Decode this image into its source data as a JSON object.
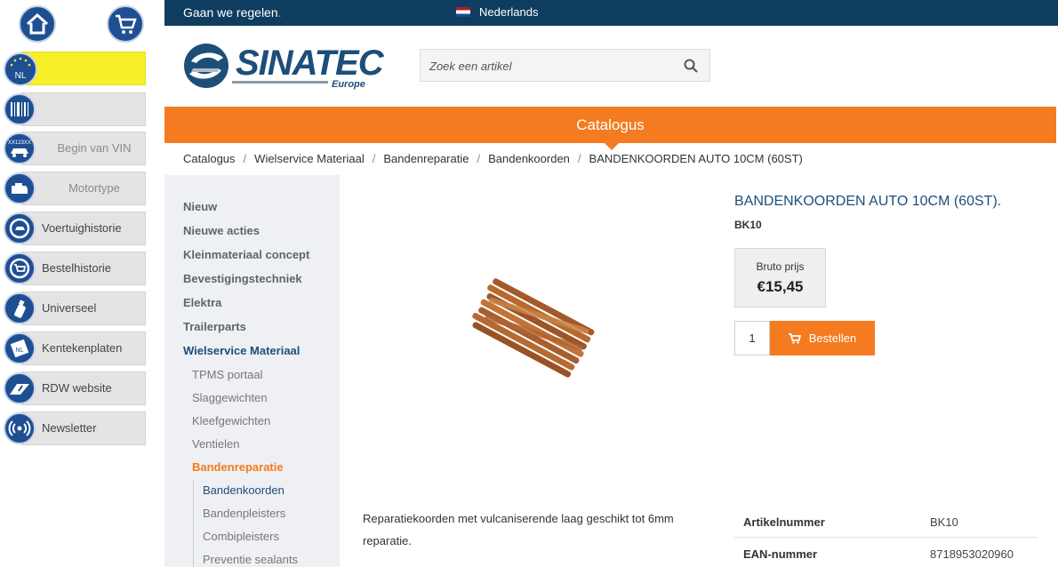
{
  "topbar": {
    "tagline": "Gaan we regelen",
    "tagline_dot": ".",
    "language": "Nederlands"
  },
  "left_sidebar": {
    "country_badge": "NL",
    "items": [
      {
        "label": ""
      },
      {
        "label": "Begin van VIN",
        "icon_text": "XX123XX"
      },
      {
        "label": "Motortype"
      },
      {
        "label": "Voertuighistorie"
      },
      {
        "label": "Bestelhistorie"
      },
      {
        "label": "Universeel"
      },
      {
        "label": "Kentekenplaten",
        "icon_text": "NL"
      },
      {
        "label": "RDW website"
      },
      {
        "label": "Newsletter"
      }
    ]
  },
  "header": {
    "logo_text": "SINATEC",
    "logo_subtext": "Europe",
    "search_placeholder": "Zoek een artikel"
  },
  "nav": {
    "catalog_label": "Catalogus"
  },
  "breadcrumb": [
    "Catalogus",
    "Wielservice Materiaal",
    "Bandenreparatie",
    "Bandenkoorden",
    "BANDENKOORDEN AUTO 10CM (60ST)"
  ],
  "breadcrumb_separator": "/",
  "category_tree": {
    "level1": [
      "Nieuw",
      "Nieuwe acties",
      "Kleinmateriaal concept",
      "Bevestigingstechniek",
      "Elektra",
      "Trailerparts",
      "Wielservice Materiaal"
    ],
    "level2": [
      "TPMS portaal",
      "Slaggewichten",
      "Kleefgewichten",
      "Ventielen",
      "Bandenreparatie"
    ],
    "level3": [
      "Bandenkoorden",
      "Bandenpleisters",
      "Combipleisters",
      "Preventie sealants"
    ]
  },
  "product": {
    "title": "BANDENKOORDEN AUTO 10CM (60ST).",
    "sku": "BK10",
    "price_label": "Bruto prijs",
    "price": "€15,45",
    "quantity": "1",
    "order_label": "Bestellen",
    "description": "Reparatiekoorden met vulcaniserende laag geschikt tot 6mm reparatie.",
    "specs": [
      {
        "key": "Artikelnummer",
        "value": "BK10"
      },
      {
        "key": "EAN-nummer",
        "value": "8718953020960"
      }
    ]
  },
  "colors": {
    "brand_blue": "#1e4f93",
    "topbar": "#0e3d5f",
    "accent_orange": "#f47b20",
    "country_yellow": "#f8ef28"
  }
}
